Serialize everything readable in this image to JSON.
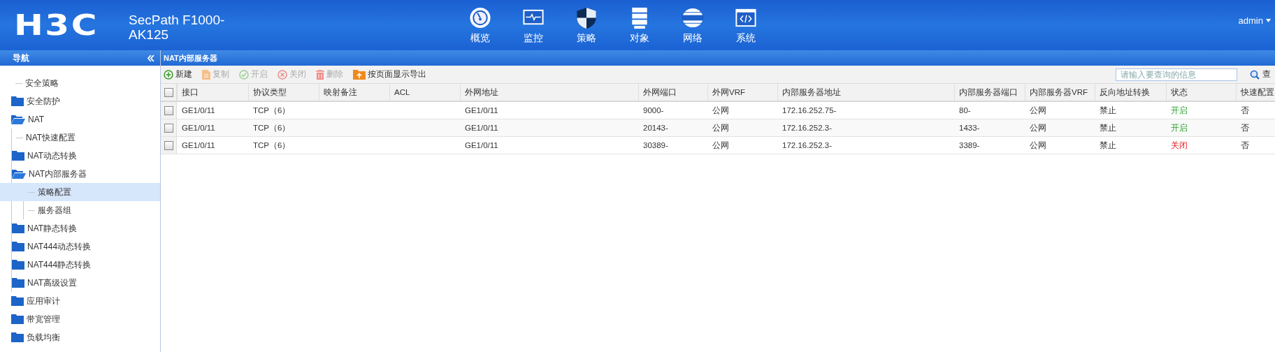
{
  "header": {
    "logo": "H3C",
    "product": "SecPath F1000-AK125",
    "nav": [
      {
        "label": "概览",
        "kind": "dashboard"
      },
      {
        "label": "监控",
        "kind": "monitor"
      },
      {
        "label": "策略",
        "kind": "shield"
      },
      {
        "label": "对象",
        "kind": "server"
      },
      {
        "label": "网络",
        "kind": "globe"
      },
      {
        "label": "系统",
        "kind": "code"
      }
    ],
    "user": "admin"
  },
  "sidebar": {
    "title": "导航",
    "items": [
      {
        "label": "安全策略",
        "kind": "leaf",
        "selected": false
      },
      {
        "label": "安全防护",
        "kind": "folder",
        "expanded": false,
        "selected": false
      },
      {
        "label": "NAT",
        "kind": "folder",
        "expanded": true,
        "selected": false,
        "children": [
          {
            "label": "NAT快速配置",
            "kind": "leaf",
            "selected": false
          },
          {
            "label": "NAT动态转换",
            "kind": "folder",
            "expanded": false,
            "selected": false
          },
          {
            "label": "NAT内部服务器",
            "kind": "folder",
            "expanded": true,
            "selected": false,
            "children": [
              {
                "label": "策略配置",
                "kind": "leaf",
                "selected": true
              },
              {
                "label": "服务器组",
                "kind": "leaf",
                "selected": false
              }
            ]
          },
          {
            "label": "NAT静态转换",
            "kind": "folder",
            "expanded": false,
            "selected": false
          },
          {
            "label": "NAT444动态转换",
            "kind": "folder",
            "expanded": false,
            "selected": false
          },
          {
            "label": "NAT444静态转换",
            "kind": "folder",
            "expanded": false,
            "selected": false
          },
          {
            "label": "NAT高级设置",
            "kind": "folder",
            "expanded": false,
            "selected": false
          }
        ]
      },
      {
        "label": "应用审计",
        "kind": "folder",
        "expanded": false,
        "selected": false
      },
      {
        "label": "带宽管理",
        "kind": "folder",
        "expanded": false,
        "selected": false
      },
      {
        "label": "负载均衡",
        "kind": "folder",
        "expanded": false,
        "selected": false
      }
    ]
  },
  "panel": {
    "title": "NAT内部服务器",
    "toolbar": [
      {
        "label": "新建",
        "kind": "add",
        "disabled": false
      },
      {
        "label": "复制",
        "kind": "copy",
        "disabled": true
      },
      {
        "label": "开启",
        "kind": "enable",
        "disabled": true
      },
      {
        "label": "关闭",
        "kind": "close",
        "disabled": true
      },
      {
        "label": "删除",
        "kind": "delete",
        "disabled": true
      },
      {
        "label": "按页面显示导出",
        "kind": "export",
        "disabled": false
      }
    ],
    "search": {
      "placeholder": "请输入要查询的信息",
      "button": "查"
    },
    "table": {
      "select_all": {
        "checked": false
      },
      "columns": [
        "接口",
        "协议类型",
        "映射备注",
        "ACL",
        "外网地址",
        "外网端口",
        "外网VRF",
        "内部服务器地址",
        "内部服务器端口",
        "内部服务器VRF",
        "反向地址转换",
        "状态",
        "快速配置"
      ],
      "rows": [
        {
          "checked": false,
          "enabled": true,
          "cells": [
            "GE1/0/11",
            "TCP（6）",
            "",
            "",
            "GE1/0/11",
            "9000-",
            "公网",
            "172.16.252.75-",
            "80-",
            "公网",
            "禁止",
            "开启",
            "否"
          ]
        },
        {
          "checked": false,
          "enabled": true,
          "cells": [
            "GE1/0/11",
            "TCP（6）",
            "",
            "",
            "GE1/0/11",
            "20143-",
            "公网",
            "172.16.252.3-",
            "1433-",
            "公网",
            "禁止",
            "开启",
            "否"
          ]
        },
        {
          "checked": false,
          "enabled": false,
          "cells": [
            "GE1/0/11",
            "TCP（6）",
            "",
            "",
            "GE1/0/11",
            "30389-",
            "公网",
            "172.16.252.3-",
            "3389-",
            "公网",
            "禁止",
            "关闭",
            "否"
          ]
        }
      ]
    }
  }
}
